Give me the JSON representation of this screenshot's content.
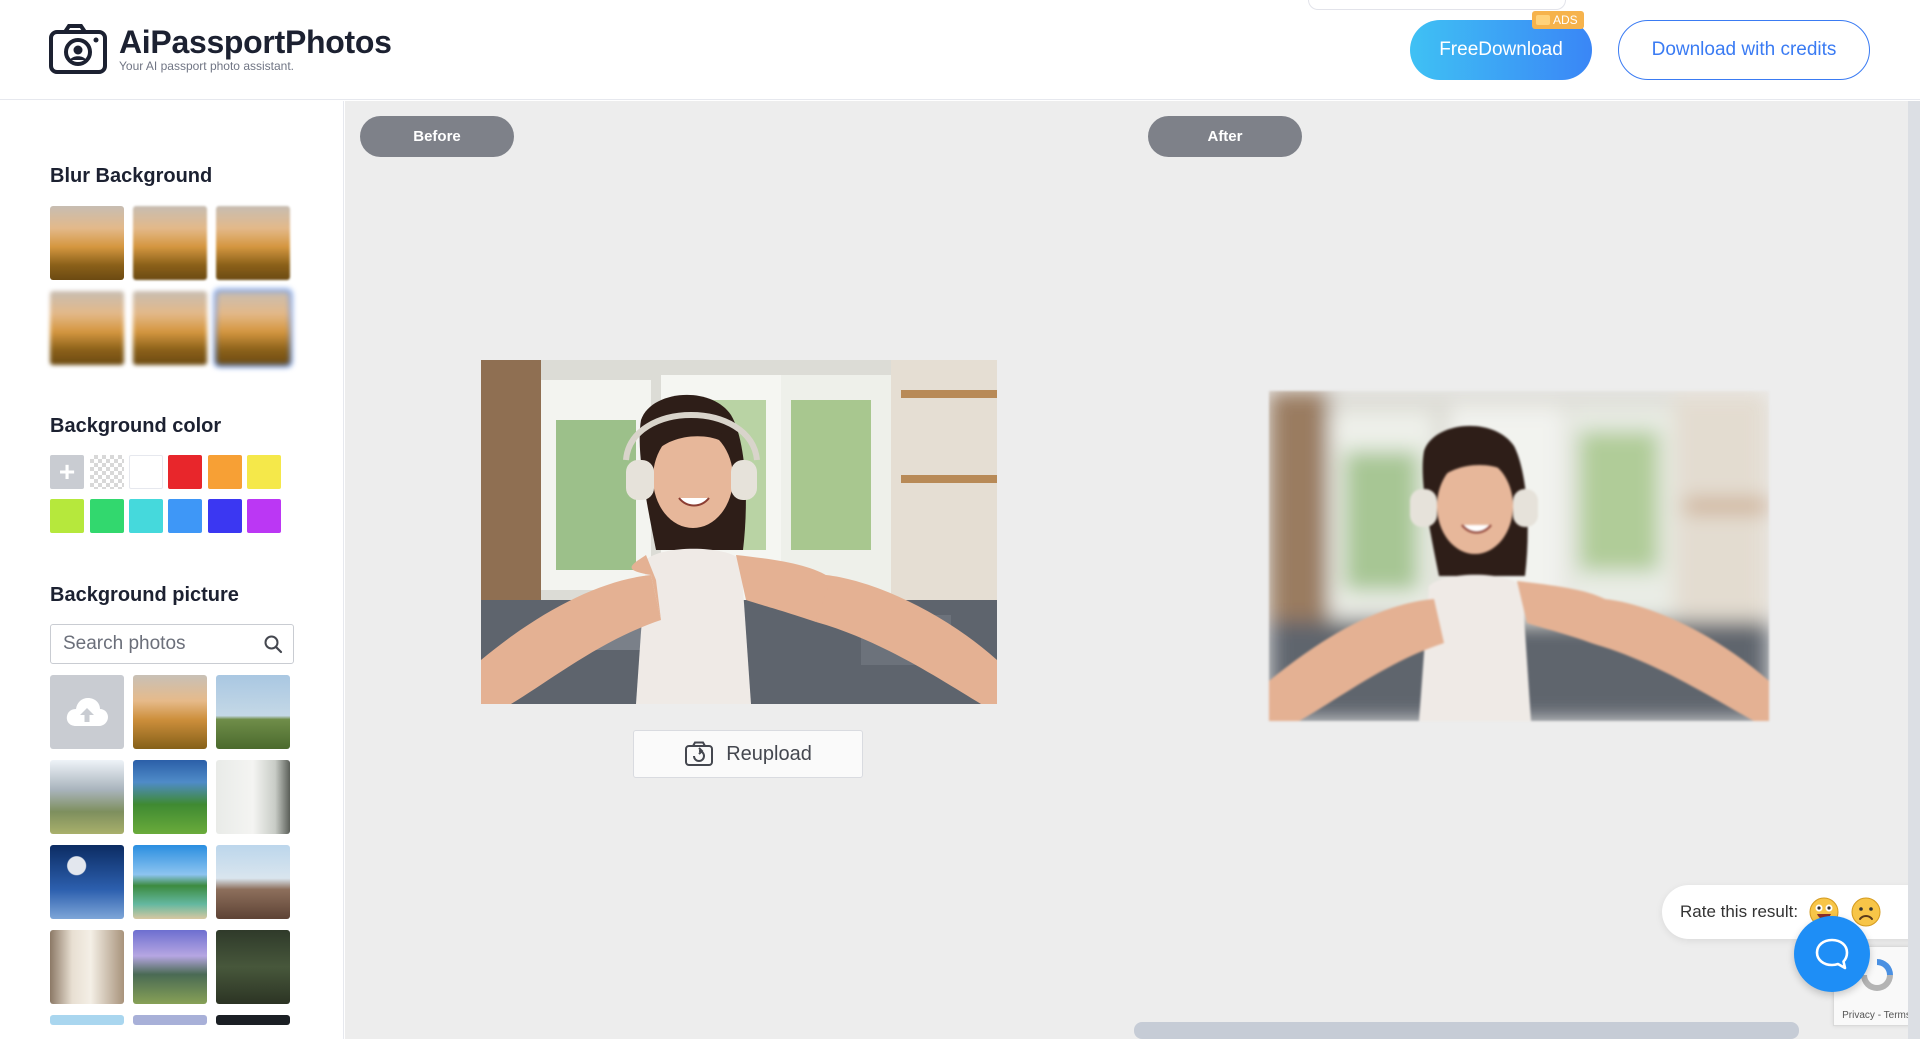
{
  "header": {
    "brand_title": "AiPassportPhotos",
    "brand_subtitle": "Your AI passport photo assistant.",
    "free_download_label": "FreeDownload",
    "ads_label": "ADS",
    "download_credits_label": "Download with credits"
  },
  "sidebar": {
    "blur_title": "Blur Background",
    "blur_count": 6,
    "blur_selected_index": 5,
    "bgcolor_title": "Background color",
    "colors": [
      "#ffffff",
      "#e8262b",
      "#f7a035",
      "#f5e84a",
      "#b6e83c",
      "#32d86e",
      "#45d9dc",
      "#3e97f7",
      "#3b37f2",
      "#bb37f4"
    ],
    "bgpicture_title": "Background picture",
    "search_placeholder": "Search photos"
  },
  "main": {
    "before_label": "Before",
    "after_label": "After",
    "reupload_label": "Reupload",
    "rate_label": "Rate this result:",
    "recaptcha_text": "Privacy - Terms"
  },
  "colors": {
    "accent": "#3a7bf3",
    "gradient_start": "#3fc1f4",
    "gradient_end": "#3a86f6",
    "tag_gray": "#7e8189",
    "chat_blue": "#1e8ef6"
  }
}
